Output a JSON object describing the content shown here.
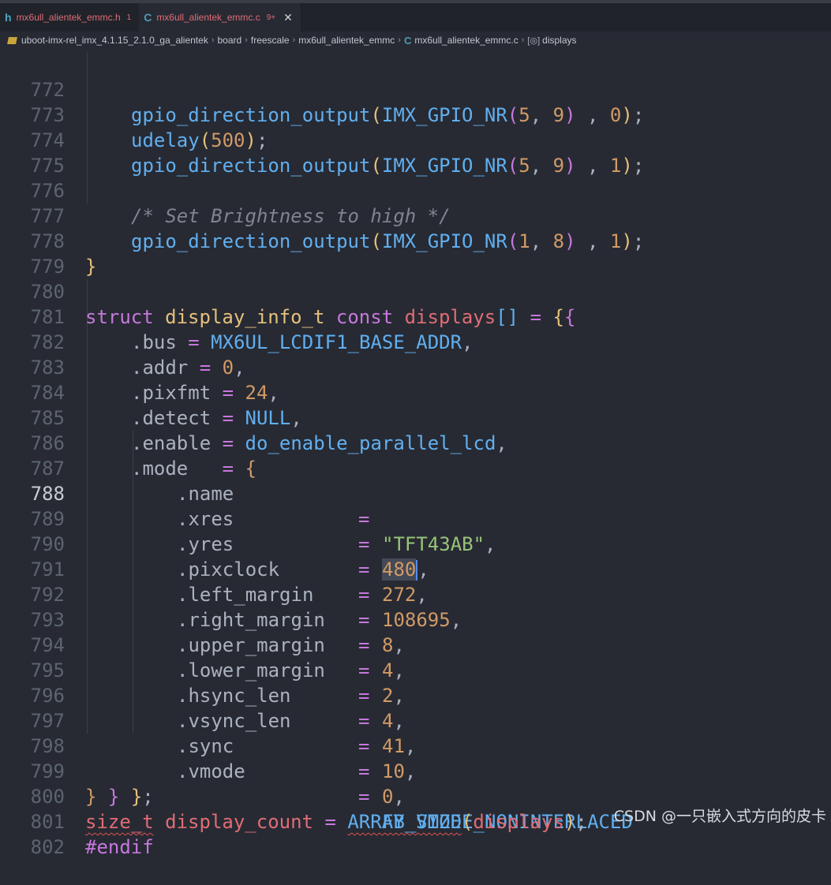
{
  "tabs": [
    {
      "icon": "h",
      "label": "mx6ull_alientek_emmc.h",
      "badge": "1"
    },
    {
      "icon": "C",
      "label": "mx6ull_alientek_emmc.c",
      "badge": "9+",
      "close": "✕"
    }
  ],
  "breadcrumb": [
    "uboot-imx-rel_imx_4.1.15_2.1.0_ga_alientek",
    "board",
    "freescale",
    "mx6ull_alientek_emmc",
    "mx6ull_alientek_emmc.c",
    "displays"
  ],
  "breadcrumb_sep": "›",
  "code": {
    "line_numbers": [
      "772",
      "773",
      "774",
      "775",
      "776",
      "777",
      "778",
      "779",
      "780",
      "781",
      "782",
      "783",
      "784",
      "785",
      "786",
      "787",
      "788",
      "789",
      "790",
      "791",
      "792",
      "793",
      "794",
      "795",
      "796",
      "797",
      "798",
      "799",
      "800",
      "801",
      "802"
    ],
    "active_line": "788",
    "l772": {
      "fn": "gpio_direction_output",
      "macro": "IMX_GPIO_NR",
      "a": "5",
      "b": "9",
      "c": "0"
    },
    "l773": {
      "fn": "udelay",
      "a": "500"
    },
    "l774": {
      "fn": "gpio_direction_output",
      "macro": "IMX_GPIO_NR",
      "a": "5",
      "b": "9",
      "c": "1"
    },
    "l776": {
      "comment": "/* Set Brightness to high */"
    },
    "l777": {
      "fn": "gpio_direction_output",
      "macro": "IMX_GPIO_NR",
      "a": "1",
      "b": "8",
      "c": "1"
    },
    "l778": {
      "text": "}"
    },
    "l780": {
      "kw1": "struct",
      "type": "display_info_t",
      "kw2": "const",
      "name": "displays"
    },
    "l781": {
      "field": ".bus",
      "value": "MX6UL_LCDIF1_BASE_ADDR"
    },
    "l782": {
      "field": ".addr",
      "value": "0"
    },
    "l783": {
      "field": ".pixfmt",
      "value": "24"
    },
    "l784": {
      "field": ".detect",
      "value": "NULL"
    },
    "l785": {
      "field": ".enable",
      "value": "do_enable_parallel_lcd"
    },
    "l786": {
      "field": ".mode"
    },
    "mode_fields": [
      {
        "field": ".name",
        "value": "\"TFT43AB\""
      },
      {
        "field": ".xres",
        "value": "480"
      },
      {
        "field": ".yres",
        "value": "272"
      },
      {
        "field": ".pixclock",
        "value": "108695"
      },
      {
        "field": ".left_margin",
        "value": "8"
      },
      {
        "field": ".right_margin",
        "value": "4"
      },
      {
        "field": ".upper_margin",
        "value": "2"
      },
      {
        "field": ".lower_margin",
        "value": "4"
      },
      {
        "field": ".hsync_len",
        "value": "41"
      },
      {
        "field": ".vsync_len",
        "value": "10"
      },
      {
        "field": ".sync",
        "value": "0"
      },
      {
        "field": ".vmode",
        "value": "FB_VMODE_NONINTERLACED"
      }
    ],
    "l800": {
      "type": "size_t",
      "var": "display_count",
      "macro": "ARRAY_SIZE",
      "arg": "displays"
    },
    "l801": {
      "text": "#endif"
    }
  },
  "watermark": "CSDN @一只嵌入式方向的皮卡"
}
